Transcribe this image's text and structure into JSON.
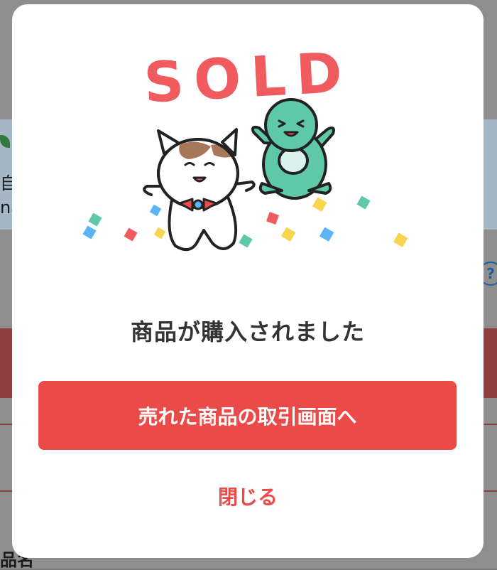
{
  "background_page": {
    "fragment_top": "",
    "left_chars": [
      "自",
      "na"
    ],
    "bottom_left": "品名",
    "help_icon": "?"
  },
  "modal": {
    "sold_text": "SOLD",
    "message": "商品が購入されました",
    "primary_button_label": "売れた商品の取引画面へ",
    "close_label": "閉じる",
    "characters": [
      "cat-mascot",
      "green-creature-mascot"
    ],
    "colors": {
      "accent": "#ea4b48",
      "sold_text": "#ef5b5f",
      "green_mascot": "#5ec8a8",
      "confetti": [
        "#5ec8a8",
        "#5ab5f5",
        "#ef5b5f",
        "#f7d54e"
      ]
    }
  }
}
